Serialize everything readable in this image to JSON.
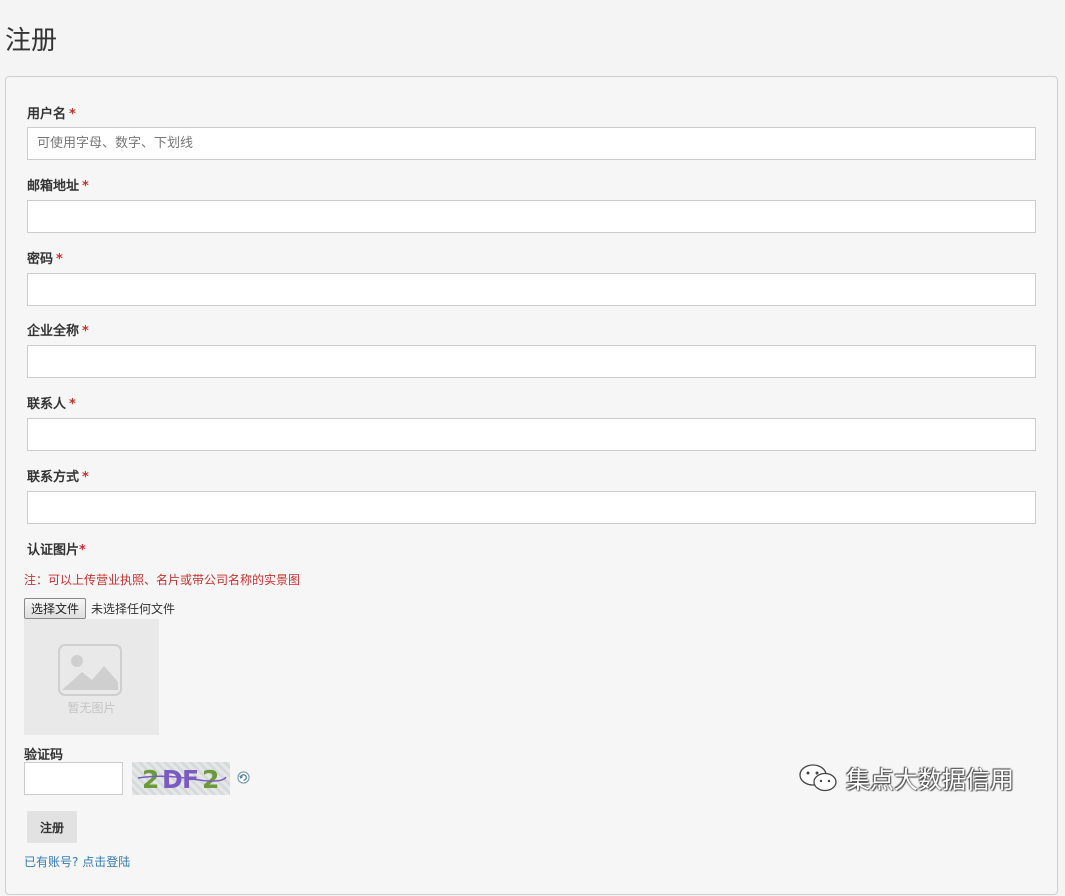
{
  "page": {
    "title": "注册"
  },
  "form": {
    "username": {
      "label": "用户名",
      "required_mark": "*",
      "placeholder": "可使用字母、数字、下划线",
      "value": ""
    },
    "email": {
      "label": "邮箱地址",
      "required_mark": "*",
      "value": ""
    },
    "password": {
      "label": "密码",
      "required_mark": "*",
      "value": ""
    },
    "company": {
      "label": "企业全称",
      "required_mark": "*",
      "value": ""
    },
    "contact": {
      "label": "联系人",
      "required_mark": "*",
      "value": ""
    },
    "contact_method": {
      "label": "联系方式",
      "required_mark": "*",
      "value": ""
    },
    "cert_image": {
      "label": "认证图片",
      "required_mark": "*",
      "note": "注：可以上传营业执照、名片或带公司名称的实景图",
      "choose_button": "选择文件",
      "file_status": "未选择任何文件",
      "preview_text": "暂无图片"
    },
    "captcha": {
      "label": "验证码",
      "image_text": "2DF2",
      "value": ""
    },
    "submit_label": "注册",
    "login_prompt": "已有账号?",
    "login_link": "点击登陆"
  },
  "watermark": {
    "text": "集点大数据信用",
    "icon": "wechat-icon"
  },
  "colors": {
    "required": "#c9302c",
    "link": "#337ab7",
    "border": "#cccccc"
  }
}
